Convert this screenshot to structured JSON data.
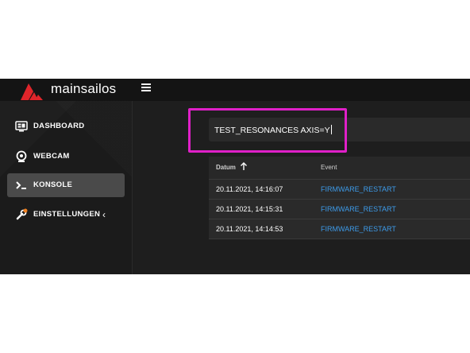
{
  "app": {
    "title": "mainsailos",
    "brand_color": "#e0252b"
  },
  "sidebar": {
    "items": [
      {
        "label": "DASHBOARD",
        "icon": "monitor-dashboard-icon",
        "active": false
      },
      {
        "label": "WEBCAM",
        "icon": "webcam-icon",
        "active": false
      },
      {
        "label": "KONSOLE",
        "icon": "console-icon",
        "active": true
      },
      {
        "label": "EINSTELLUNGEN",
        "icon": "wrench-settings-icon",
        "active": false,
        "chevron": "‹"
      }
    ]
  },
  "console": {
    "command_value": "TEST_RESONANCES AXIS=Y",
    "highlight_color": "#e020c8"
  },
  "history": {
    "columns": [
      "Datum",
      "Event"
    ],
    "sort_icon": "arrow-up-icon",
    "rows": [
      {
        "date": "20.11.2021, 14:16:07",
        "event": "FIRMWARE_RESTART"
      },
      {
        "date": "20.11.2021, 14:15:31",
        "event": "FIRMWARE_RESTART"
      },
      {
        "date": "20.11.2021, 14:14:53",
        "event": "FIRMWARE_RESTART"
      }
    ],
    "link_color": "#3d9be9"
  }
}
